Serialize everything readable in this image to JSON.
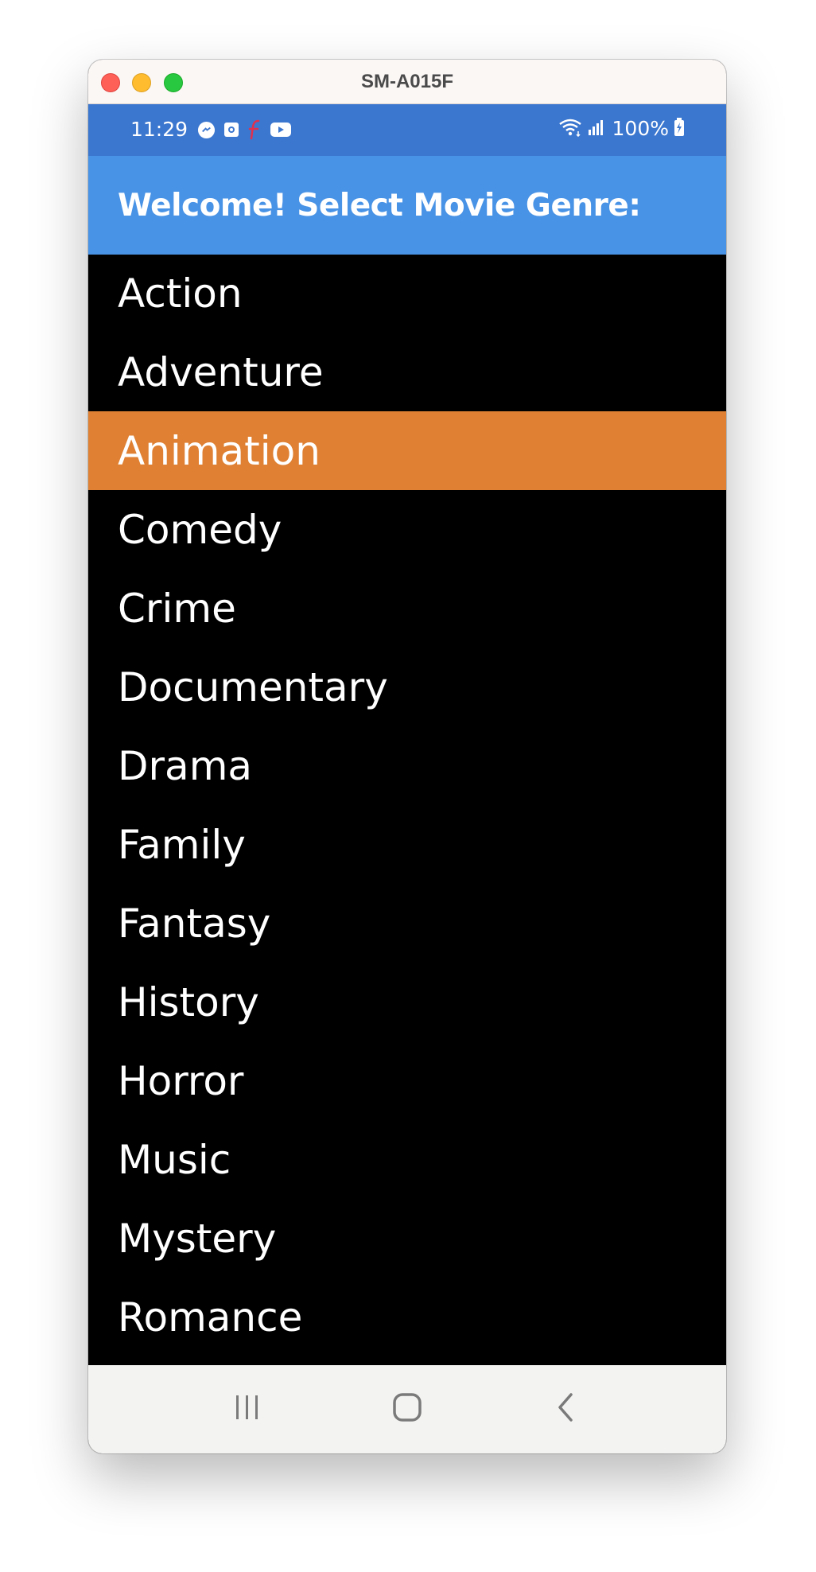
{
  "window": {
    "title": "SM-A015F"
  },
  "statusbar": {
    "time": "11:29",
    "battery": "100%",
    "left_icons": [
      "messenger-icon",
      "outlook-icon",
      "f-app-icon",
      "youtube-icon"
    ],
    "right_icons": [
      "wifi-icon",
      "signal-icon",
      "battery-charging-icon"
    ]
  },
  "appbar": {
    "title": "Welcome! Select Movie Genre:"
  },
  "genres": [
    "Action",
    "Adventure",
    "Animation",
    "Comedy",
    "Crime",
    "Documentary",
    "Drama",
    "Family",
    "Fantasy",
    "History",
    "Horror",
    "Music",
    "Mystery",
    "Romance"
  ],
  "selected_genre": "Animation",
  "colors": {
    "statusbar": "#3c77cf",
    "appbar": "#4993e6",
    "selected": "#df8032",
    "list_background": "#000000",
    "navbar": "#f3f4f2"
  },
  "navbar": {
    "buttons": [
      "recent-apps-icon",
      "home-icon",
      "back-icon"
    ]
  }
}
